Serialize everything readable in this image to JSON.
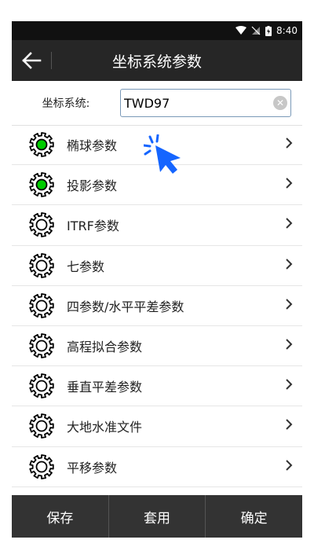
{
  "status": {
    "time": "8:40"
  },
  "header": {
    "title": "坐标系统参数"
  },
  "coord_system": {
    "label": "坐标系统:",
    "value": "TWD97"
  },
  "items": [
    {
      "label": "椭球参数",
      "active": true
    },
    {
      "label": "投影参数",
      "active": true
    },
    {
      "label": "ITRF参数",
      "active": false
    },
    {
      "label": "七参数",
      "active": false
    },
    {
      "label": "四参数/水平平差参数",
      "active": false
    },
    {
      "label": "高程拟合参数",
      "active": false
    },
    {
      "label": "垂直平差参数",
      "active": false
    },
    {
      "label": "大地水准文件",
      "active": false
    },
    {
      "label": "平移参数",
      "active": false
    }
  ],
  "buttons": {
    "save": "保存",
    "apply": "套用",
    "confirm": "确定"
  },
  "colors": {
    "active_gear": "#00cc00",
    "accent": "#1565ff"
  },
  "icons": {
    "back": "back-arrow-icon",
    "gear": "gear-icon",
    "chevron": "chevron-right-icon",
    "clear": "clear-icon"
  }
}
